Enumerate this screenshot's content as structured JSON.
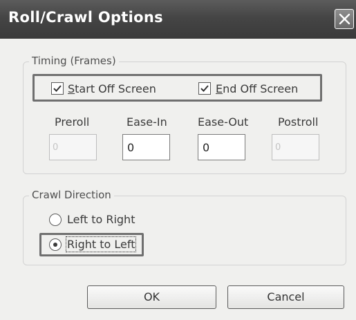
{
  "window": {
    "title": "Roll/Crawl Options",
    "close_icon": "close-icon"
  },
  "timing": {
    "legend": "Timing (Frames)",
    "start_off_screen": {
      "accel": "S",
      "rest": "tart Off Screen",
      "checked": true
    },
    "end_off_screen": {
      "accel": "E",
      "rest": "nd Off Screen",
      "checked": true
    },
    "columns": [
      {
        "label": "Preroll",
        "value": "0",
        "enabled": false
      },
      {
        "label": "Ease-In",
        "value": "0",
        "enabled": true
      },
      {
        "label": "Ease-Out",
        "value": "0",
        "enabled": true
      },
      {
        "label": "Postroll",
        "value": "0",
        "enabled": false
      }
    ]
  },
  "crawl": {
    "legend": "Crawl Direction",
    "options": [
      {
        "label": "Left to Right",
        "selected": false
      },
      {
        "label": "Right to Left",
        "selected": true
      }
    ]
  },
  "buttons": {
    "ok": "OK",
    "cancel": "Cancel"
  },
  "colors": {
    "title_bar": "#454545",
    "dialog_bg": "#f0f0ee",
    "highlight": "#6f6f6f"
  }
}
